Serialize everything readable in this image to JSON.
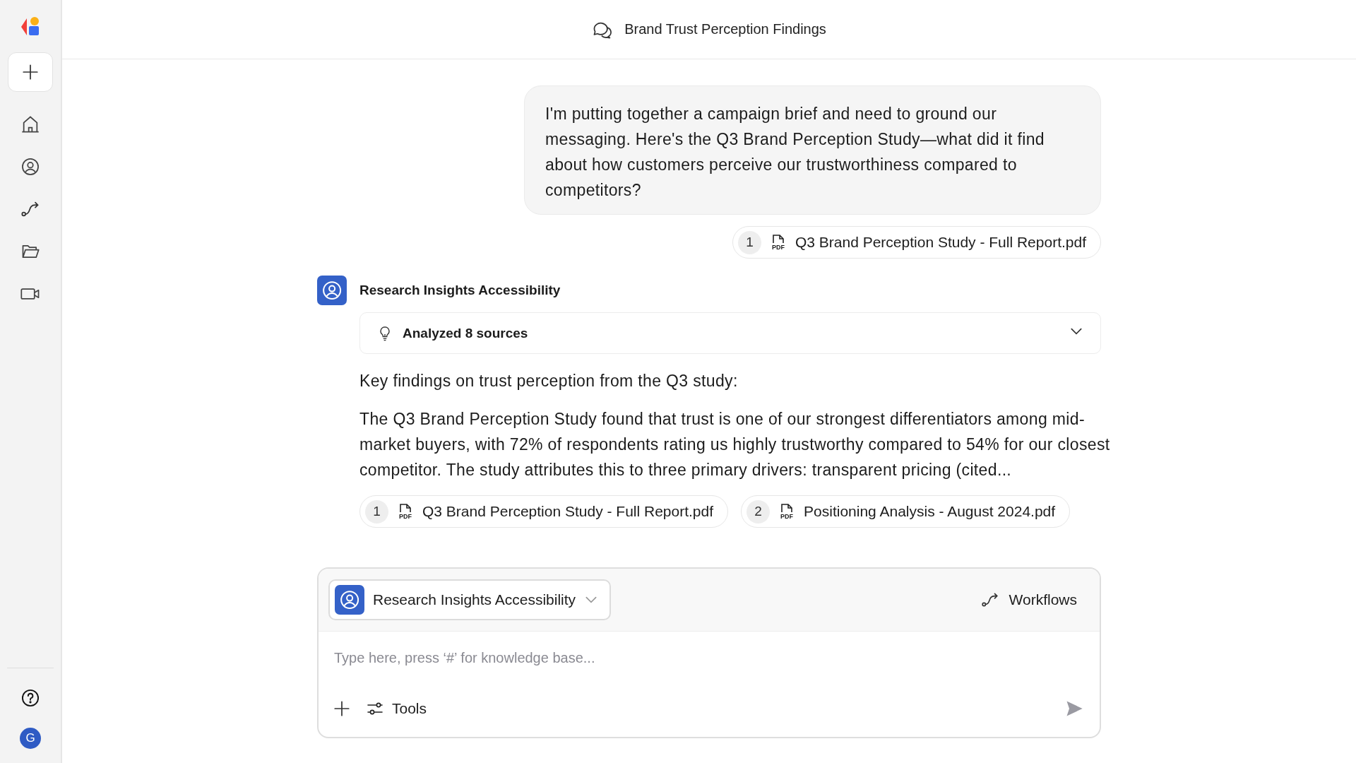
{
  "sidebar": {
    "user_avatar": "G"
  },
  "header": {
    "title": "Brand Trust Perception Findings"
  },
  "user_message": {
    "text": "I'm putting together a campaign brief and need to ground our messaging. Here's the Q3 Brand Perception Study—what did it find about how customers perceive our trustworthiness compared to competitors?",
    "attachments": [
      {
        "index": "1",
        "file_type": "PDF",
        "name": "Q3 Brand Perception Study - Full Report.pdf"
      }
    ]
  },
  "agent_message": {
    "name": "Research Insights Accessibility",
    "sources": {
      "label": "Analyzed 8 sources",
      "expanded": false
    },
    "intro": "Key findings on trust perception from the Q3 study:",
    "body": "The Q3 Brand Perception Study found that trust is one of our strongest differentiators among mid-market buyers, with 72% of respondents rating us highly trustworthy compared to 54% for our closest competitor. The study attributes this to three primary drivers: transparent pricing (cited...",
    "citations": [
      {
        "index": "1",
        "file_type": "PDF",
        "name": "Q3 Brand Perception Study - Full Report.pdf"
      },
      {
        "index": "2",
        "file_type": "PDF",
        "name": "Positioning Analysis - August 2024.pdf"
      }
    ]
  },
  "composer": {
    "agent": "Research Insights Accessibility",
    "workflows": "Workflows",
    "placeholder": "Type here, press ‘#’ for knowledge base...",
    "tools": "Tools"
  }
}
